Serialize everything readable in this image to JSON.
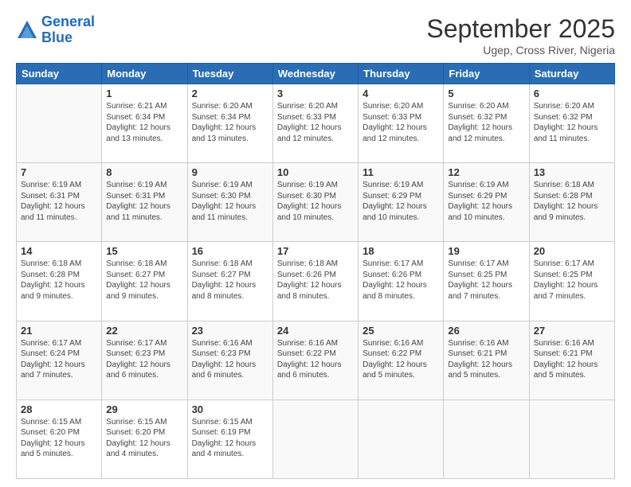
{
  "logo": {
    "line1": "General",
    "line2": "Blue"
  },
  "header": {
    "month": "September 2025",
    "location": "Ugep, Cross River, Nigeria"
  },
  "days_of_week": [
    "Sunday",
    "Monday",
    "Tuesday",
    "Wednesday",
    "Thursday",
    "Friday",
    "Saturday"
  ],
  "weeks": [
    [
      {
        "day": "",
        "info": ""
      },
      {
        "day": "1",
        "info": "Sunrise: 6:21 AM\nSunset: 6:34 PM\nDaylight: 12 hours\nand 13 minutes."
      },
      {
        "day": "2",
        "info": "Sunrise: 6:20 AM\nSunset: 6:34 PM\nDaylight: 12 hours\nand 13 minutes."
      },
      {
        "day": "3",
        "info": "Sunrise: 6:20 AM\nSunset: 6:33 PM\nDaylight: 12 hours\nand 12 minutes."
      },
      {
        "day": "4",
        "info": "Sunrise: 6:20 AM\nSunset: 6:33 PM\nDaylight: 12 hours\nand 12 minutes."
      },
      {
        "day": "5",
        "info": "Sunrise: 6:20 AM\nSunset: 6:32 PM\nDaylight: 12 hours\nand 12 minutes."
      },
      {
        "day": "6",
        "info": "Sunrise: 6:20 AM\nSunset: 6:32 PM\nDaylight: 12 hours\nand 11 minutes."
      }
    ],
    [
      {
        "day": "7",
        "info": "Sunrise: 6:19 AM\nSunset: 6:31 PM\nDaylight: 12 hours\nand 11 minutes."
      },
      {
        "day": "8",
        "info": "Sunrise: 6:19 AM\nSunset: 6:31 PM\nDaylight: 12 hours\nand 11 minutes."
      },
      {
        "day": "9",
        "info": "Sunrise: 6:19 AM\nSunset: 6:30 PM\nDaylight: 12 hours\nand 11 minutes."
      },
      {
        "day": "10",
        "info": "Sunrise: 6:19 AM\nSunset: 6:30 PM\nDaylight: 12 hours\nand 10 minutes."
      },
      {
        "day": "11",
        "info": "Sunrise: 6:19 AM\nSunset: 6:29 PM\nDaylight: 12 hours\nand 10 minutes."
      },
      {
        "day": "12",
        "info": "Sunrise: 6:19 AM\nSunset: 6:29 PM\nDaylight: 12 hours\nand 10 minutes."
      },
      {
        "day": "13",
        "info": "Sunrise: 6:18 AM\nSunset: 6:28 PM\nDaylight: 12 hours\nand 9 minutes."
      }
    ],
    [
      {
        "day": "14",
        "info": "Sunrise: 6:18 AM\nSunset: 6:28 PM\nDaylight: 12 hours\nand 9 minutes."
      },
      {
        "day": "15",
        "info": "Sunrise: 6:18 AM\nSunset: 6:27 PM\nDaylight: 12 hours\nand 9 minutes."
      },
      {
        "day": "16",
        "info": "Sunrise: 6:18 AM\nSunset: 6:27 PM\nDaylight: 12 hours\nand 8 minutes."
      },
      {
        "day": "17",
        "info": "Sunrise: 6:18 AM\nSunset: 6:26 PM\nDaylight: 12 hours\nand 8 minutes."
      },
      {
        "day": "18",
        "info": "Sunrise: 6:17 AM\nSunset: 6:26 PM\nDaylight: 12 hours\nand 8 minutes."
      },
      {
        "day": "19",
        "info": "Sunrise: 6:17 AM\nSunset: 6:25 PM\nDaylight: 12 hours\nand 7 minutes."
      },
      {
        "day": "20",
        "info": "Sunrise: 6:17 AM\nSunset: 6:25 PM\nDaylight: 12 hours\nand 7 minutes."
      }
    ],
    [
      {
        "day": "21",
        "info": "Sunrise: 6:17 AM\nSunset: 6:24 PM\nDaylight: 12 hours\nand 7 minutes."
      },
      {
        "day": "22",
        "info": "Sunrise: 6:17 AM\nSunset: 6:23 PM\nDaylight: 12 hours\nand 6 minutes."
      },
      {
        "day": "23",
        "info": "Sunrise: 6:16 AM\nSunset: 6:23 PM\nDaylight: 12 hours\nand 6 minutes."
      },
      {
        "day": "24",
        "info": "Sunrise: 6:16 AM\nSunset: 6:22 PM\nDaylight: 12 hours\nand 6 minutes."
      },
      {
        "day": "25",
        "info": "Sunrise: 6:16 AM\nSunset: 6:22 PM\nDaylight: 12 hours\nand 5 minutes."
      },
      {
        "day": "26",
        "info": "Sunrise: 6:16 AM\nSunset: 6:21 PM\nDaylight: 12 hours\nand 5 minutes."
      },
      {
        "day": "27",
        "info": "Sunrise: 6:16 AM\nSunset: 6:21 PM\nDaylight: 12 hours\nand 5 minutes."
      }
    ],
    [
      {
        "day": "28",
        "info": "Sunrise: 6:15 AM\nSunset: 6:20 PM\nDaylight: 12 hours\nand 5 minutes."
      },
      {
        "day": "29",
        "info": "Sunrise: 6:15 AM\nSunset: 6:20 PM\nDaylight: 12 hours\nand 4 minutes."
      },
      {
        "day": "30",
        "info": "Sunrise: 6:15 AM\nSunset: 6:19 PM\nDaylight: 12 hours\nand 4 minutes."
      },
      {
        "day": "",
        "info": ""
      },
      {
        "day": "",
        "info": ""
      },
      {
        "day": "",
        "info": ""
      },
      {
        "day": "",
        "info": ""
      }
    ]
  ]
}
